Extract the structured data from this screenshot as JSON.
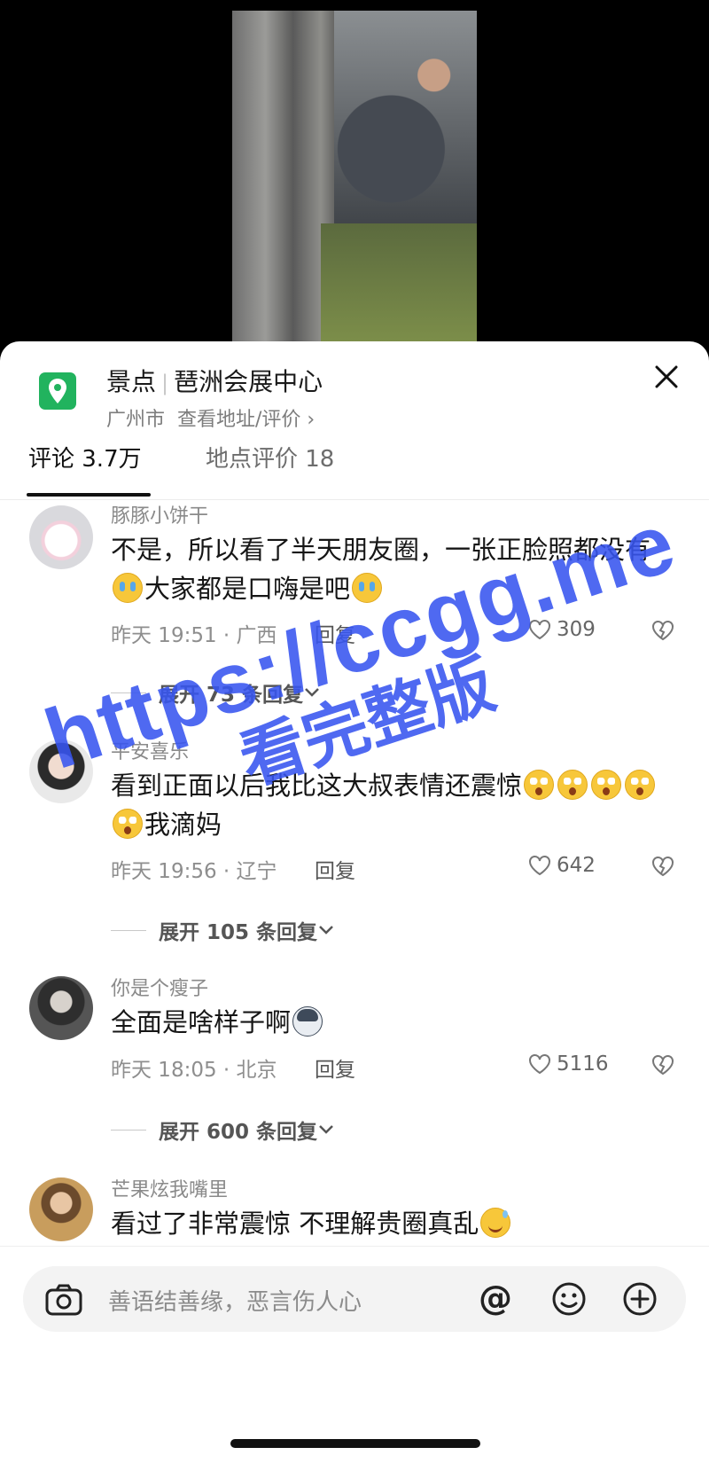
{
  "location": {
    "category": "景点",
    "name": "琶洲会展中心",
    "city": "广州市",
    "link": "查看地址/评价 ›"
  },
  "tabs": {
    "comments": "评论 3.7万",
    "reviews": "地点评价 18"
  },
  "comments": [
    {
      "author": "豚豚小饼干",
      "text_a": "不是，所以看了半天朋友圈，一张正脸照都没有",
      "text_b": "大家都是口嗨是吧",
      "time_loc": "昨天 19:51 · 广西",
      "reply": "回复",
      "likes": "309",
      "expand": "展开 73 条回复"
    },
    {
      "author": "平安喜乐",
      "text_a": "看到正面以后我比这大叔表情还震惊",
      "text_b": "我滴妈",
      "time_loc": "昨天 19:56 · 辽宁",
      "reply": "回复",
      "likes": "642",
      "expand": "展开 105 条回复"
    },
    {
      "author": "你是个瘦子",
      "text_a": "全面是啥样子啊",
      "time_loc": "昨天 18:05 · 北京",
      "reply": "回复",
      "likes": "5116",
      "expand": "展开 600 条回复"
    },
    {
      "author": "芒果炫我嘴里",
      "text_a": "看过了非常震惊 不理解贵圈真乱"
    }
  ],
  "input": {
    "placeholder": "善语结善缘，恶言伤人心",
    "at_symbol": "@"
  },
  "watermark": {
    "line1": "https://ccgg.me",
    "line2": "看完整版"
  },
  "colors": {
    "location_pin": "#21b35e",
    "watermark": "#3755f0"
  }
}
